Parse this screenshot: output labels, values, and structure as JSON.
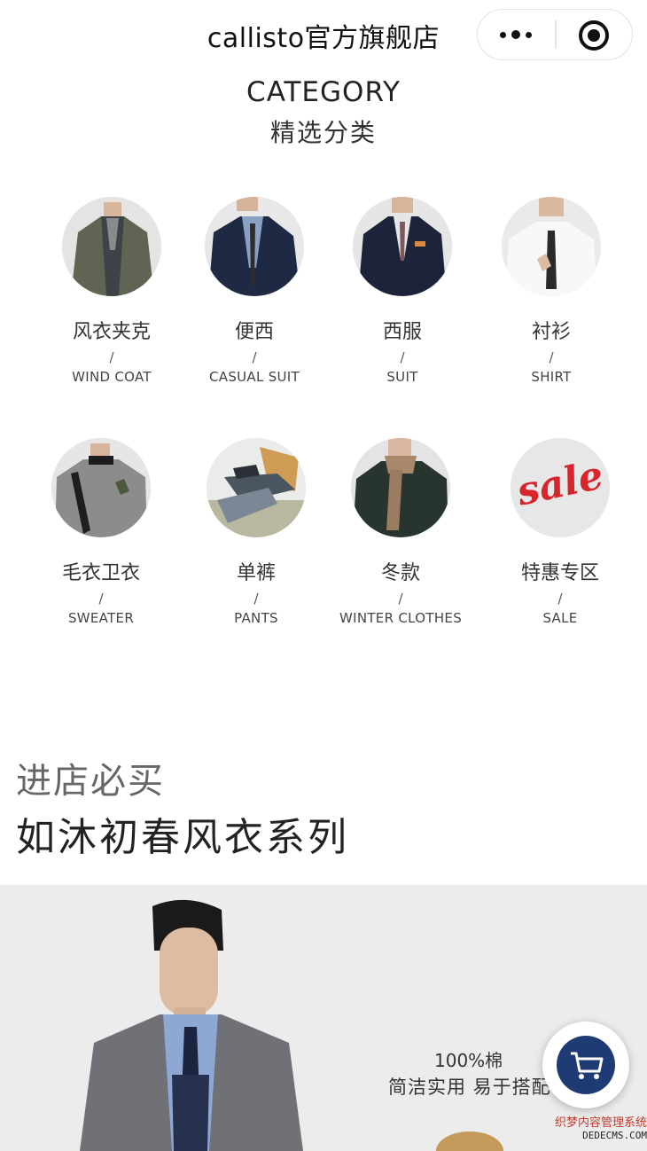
{
  "navbar": {
    "title": "callisto官方旗舰店",
    "more_icon": "more-dots-icon",
    "close_icon": "target-close-icon"
  },
  "category_header": {
    "title_en": "CATEGORY",
    "title_cn": "精选分类"
  },
  "categories": [
    {
      "name_cn": "风衣夹克",
      "slash": "/",
      "name_en": "WIND COAT"
    },
    {
      "name_cn": "便西",
      "slash": "/",
      "name_en": "CASUAL SUIT"
    },
    {
      "name_cn": "西服",
      "slash": "/",
      "name_en": "SUIT"
    },
    {
      "name_cn": "衬衫",
      "slash": "/",
      "name_en": "SHIRT"
    },
    {
      "name_cn": "毛衣卫衣",
      "slash": "/",
      "name_en": "SWEATER"
    },
    {
      "name_cn": "单裤",
      "slash": "/",
      "name_en": "PANTS"
    },
    {
      "name_cn": "冬款",
      "slash": "/",
      "name_en": "WINTER CLOTHES"
    },
    {
      "name_cn": "特惠专区",
      "slash": "/",
      "name_en": "SALE"
    }
  ],
  "sale_badge_text": "sale",
  "section": {
    "subtitle": "进店必买",
    "title": "如沐初春风衣系列"
  },
  "banner": {
    "line1": "100%棉",
    "line2": "简洁实用 易于搭配"
  },
  "cart_fab": {
    "icon": "shopping-cart-icon"
  },
  "watermark": {
    "line1": "织梦内容管理系统",
    "line2": "DEDECMS.COM"
  }
}
